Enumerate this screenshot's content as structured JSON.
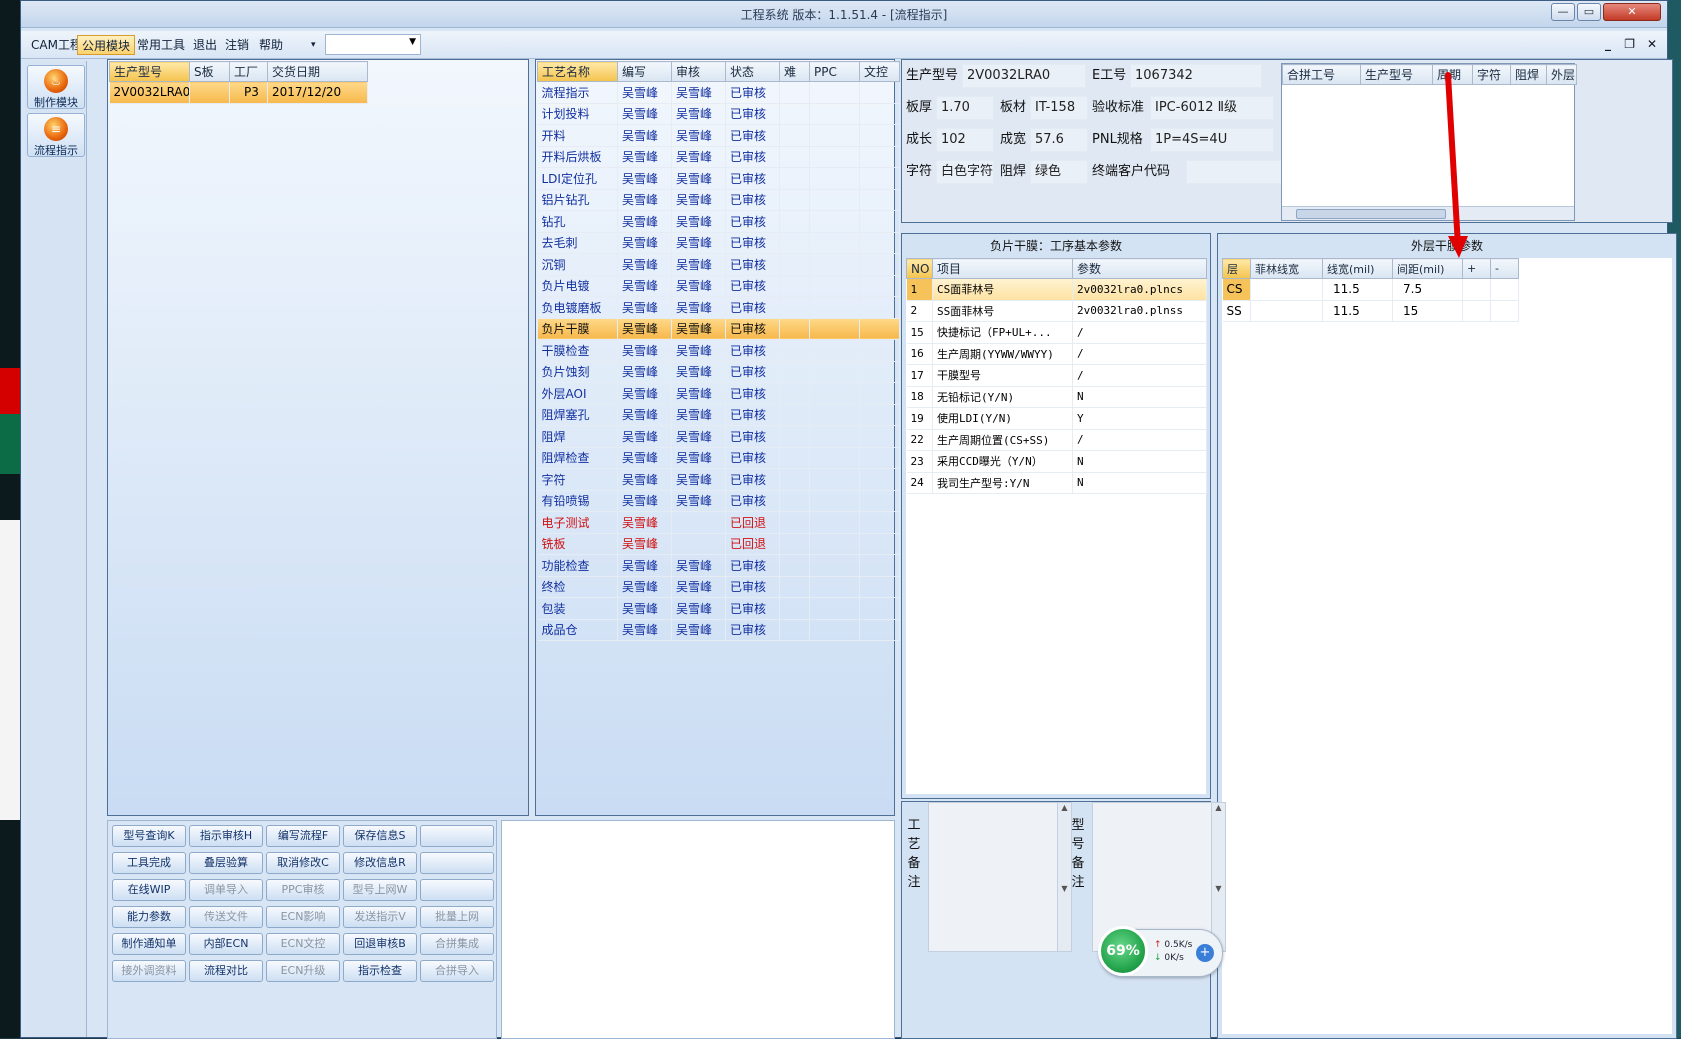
{
  "window": {
    "title": "工程系统   版本：1.1.51.4 - [流程指示]",
    "min": "—",
    "max": "▭",
    "close": "✕"
  },
  "menu": {
    "items": [
      "CAM工程",
      "公用模块",
      "常用工具",
      "退出",
      "注销",
      "帮助"
    ],
    "mdi": [
      "_",
      "❐",
      "✕"
    ]
  },
  "nav": [
    {
      "label": "制作模块",
      "icon": "flame-icon"
    },
    {
      "label": "流程指示",
      "icon": "stack-icon"
    }
  ],
  "product_list": {
    "columns": [
      "生产型号",
      "S板",
      "工厂",
      "交货日期"
    ],
    "rows": [
      [
        "2V0032LRA0",
        "",
        "P3",
        "2017/12/20"
      ]
    ]
  },
  "process": {
    "columns": [
      "工艺名称",
      "编写",
      "审核",
      "状态",
      "难",
      "PPC",
      "文控"
    ],
    "rows": [
      [
        "流程指示",
        "吴雪峰",
        "吴雪峰",
        "已审核"
      ],
      [
        "计划投料",
        "吴雪峰",
        "吴雪峰",
        "已审核"
      ],
      [
        "开料",
        "吴雪峰",
        "吴雪峰",
        "已审核"
      ],
      [
        "开料后烘板",
        "吴雪峰",
        "吴雪峰",
        "已审核"
      ],
      [
        "LDI定位孔",
        "吴雪峰",
        "吴雪峰",
        "已审核"
      ],
      [
        "铝片钻孔",
        "吴雪峰",
        "吴雪峰",
        "已审核"
      ],
      [
        "钻孔",
        "吴雪峰",
        "吴雪峰",
        "已审核"
      ],
      [
        "去毛刺",
        "吴雪峰",
        "吴雪峰",
        "已审核"
      ],
      [
        "沉铜",
        "吴雪峰",
        "吴雪峰",
        "已审核"
      ],
      [
        "负片电镀",
        "吴雪峰",
        "吴雪峰",
        "已审核"
      ],
      [
        "负电镀磨板",
        "吴雪峰",
        "吴雪峰",
        "已审核"
      ],
      [
        "负片干膜",
        "吴雪峰",
        "吴雪峰",
        "已审核"
      ],
      [
        "干膜检查",
        "吴雪峰",
        "吴雪峰",
        "已审核"
      ],
      [
        "负片蚀刻",
        "吴雪峰",
        "吴雪峰",
        "已审核"
      ],
      [
        "外层AOI",
        "吴雪峰",
        "吴雪峰",
        "已审核"
      ],
      [
        "阻焊塞孔",
        "吴雪峰",
        "吴雪峰",
        "已审核"
      ],
      [
        "阻焊",
        "吴雪峰",
        "吴雪峰",
        "已审核"
      ],
      [
        "阻焊检查",
        "吴雪峰",
        "吴雪峰",
        "已审核"
      ],
      [
        "字符",
        "吴雪峰",
        "吴雪峰",
        "已审核"
      ],
      [
        "有铅喷锡",
        "吴雪峰",
        "吴雪峰",
        "已审核"
      ],
      [
        "电子测试",
        "吴雪峰",
        "",
        "已回退"
      ],
      [
        "铣板",
        "吴雪峰",
        "",
        "已回退"
      ],
      [
        "功能检查",
        "吴雪峰",
        "吴雪峰",
        "已审核"
      ],
      [
        "终检",
        "吴雪峰",
        "吴雪峰",
        "已审核"
      ],
      [
        "包装",
        "吴雪峰",
        "吴雪峰",
        "已审核"
      ],
      [
        "成品仓",
        "吴雪峰",
        "吴雪峰",
        "已审核"
      ]
    ],
    "selected_index": 11,
    "rejected_indices": [
      20,
      21
    ]
  },
  "info": {
    "model_label": "生产型号",
    "model": "2V0032LRA0",
    "eno_label": "E工号",
    "eno": "1067342",
    "thick_label": "板厚",
    "thick": "1.70",
    "mat_label": "板材",
    "mat": "IT-158",
    "std_label": "验收标准",
    "std": "IPC-6012 Ⅱ级",
    "len_label": "成长",
    "len": "102",
    "wid_label": "成宽",
    "wid": "57.6",
    "pnl_label": "PNL规格",
    "pnl": "1P=4S=4U",
    "char_label": "字符",
    "char": "白色字符",
    "mask_label": "阻焊",
    "mask": "绿色",
    "cust_label": "终端客户代码",
    "cust": ""
  },
  "merge_grid": {
    "columns": [
      "合拼工号",
      "生产型号",
      "周期",
      "字符",
      "阻焊",
      "外层"
    ]
  },
  "params_panel": {
    "caption": "负片干膜：工序基本参数",
    "columns": [
      "NO",
      "项目",
      "参数"
    ],
    "rows": [
      [
        "1",
        "CS面菲林号",
        "2v0032lra0.plncs"
      ],
      [
        "2",
        "SS面菲林号",
        "2v0032lra0.plnss"
      ],
      [
        "15",
        "快捷标记（FP+UL+...",
        "/"
      ],
      [
        "16",
        "生产周期(YYWW/WWYY)",
        "/"
      ],
      [
        "17",
        "干膜型号",
        "/"
      ],
      [
        "18",
        "无铅标记(Y/N)",
        "N"
      ],
      [
        "19",
        "使用LDI(Y/N)",
        "Y"
      ],
      [
        "22",
        "生产周期位置(CS+SS)",
        "/"
      ],
      [
        "23",
        "采用CCD曝光（Y/N）",
        "N"
      ],
      [
        "24",
        "我司生产型号:Y/N",
        "N"
      ]
    ]
  },
  "outer_panel": {
    "caption": "外层干膜参数",
    "columns": [
      "层",
      "菲林线宽",
      "线宽(mil)",
      "间距(mil)",
      "+",
      "-"
    ],
    "rows": [
      [
        "CS",
        "",
        "11.5",
        "7.5",
        "",
        ""
      ],
      [
        "SS",
        "",
        "11.5",
        "15",
        "",
        ""
      ]
    ]
  },
  "buttons": [
    [
      "型号查询K",
      "指示审核H",
      "编写流程F",
      "保存信息S",
      ""
    ],
    [
      "工具完成",
      "叠层验算",
      "取消修改C",
      "修改信息R",
      ""
    ],
    [
      "在线WIP",
      "调单导入",
      "PPC审核",
      "型号上网W",
      ""
    ],
    [
      "能力参数",
      "传送文件",
      "ECN影响",
      "发送指示V",
      "批量上网"
    ],
    [
      "制作通知单",
      "内部ECN",
      "ECN文控",
      "回退审核B",
      "合拼集成"
    ],
    [
      "接外调资料",
      "流程对比",
      "ECN升级",
      "指示检查",
      "合拼导入"
    ]
  ],
  "disabled_buttons": [
    "调单导入",
    "PPC审核",
    "型号上网W",
    "传送文件",
    "ECN影响",
    "发送指示V",
    "批量上网",
    "ECN文控",
    "合拼集成",
    "接外调资料",
    "ECN升级",
    "合拼导入"
  ],
  "notes": {
    "process_label": "工艺备注",
    "model_label": "型号备注"
  },
  "net": {
    "percent": "69%",
    "up": "0.5K/s",
    "down": "0K/s"
  },
  "colors": {
    "accent": "#f6b84b",
    "reject": "#d01010",
    "text_blue": "#1230a0",
    "arrow": "#e00000"
  }
}
